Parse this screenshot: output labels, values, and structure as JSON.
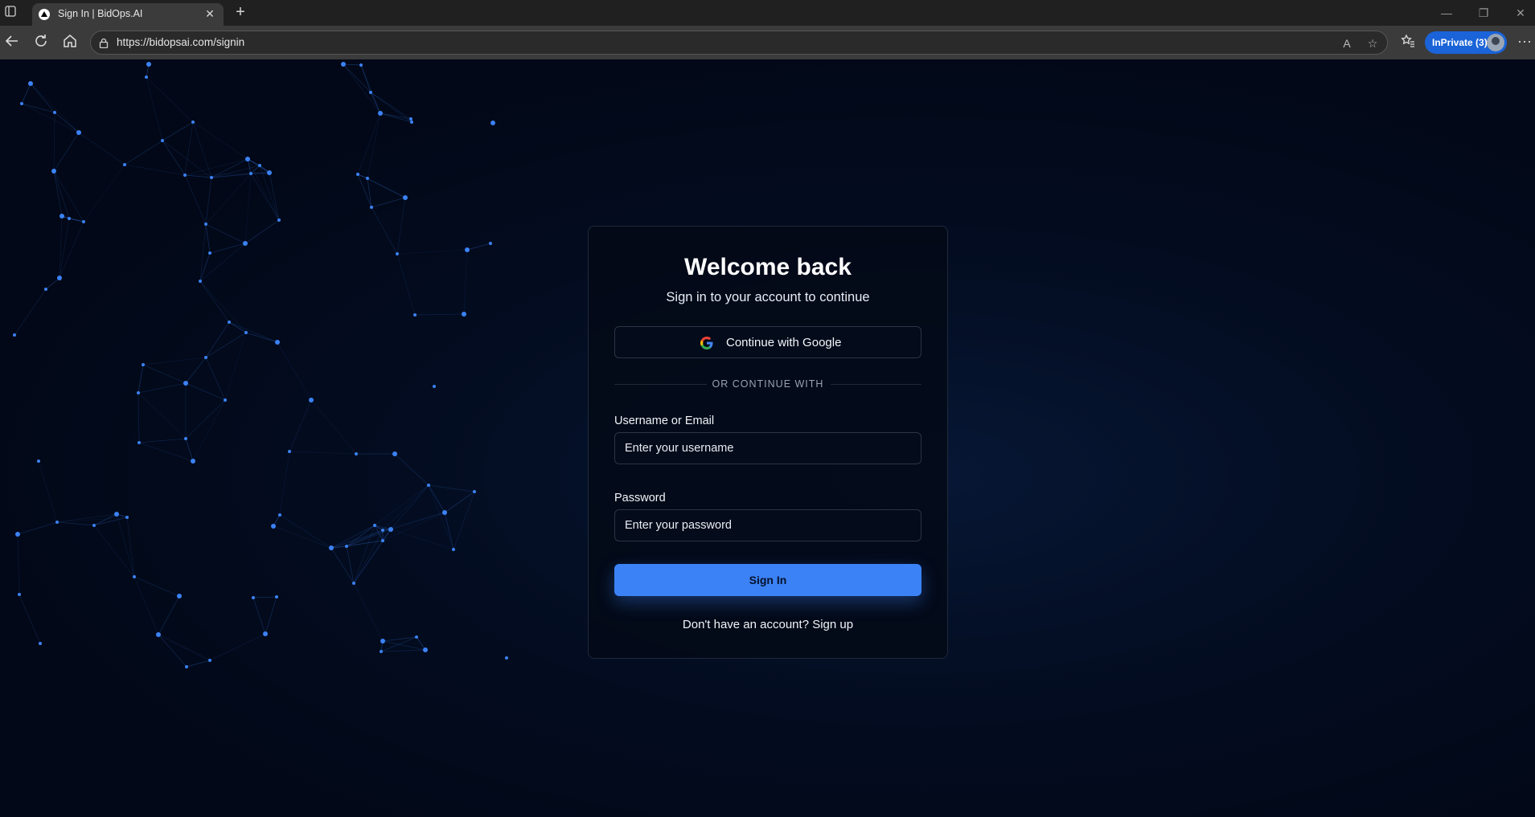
{
  "browser": {
    "tab_title": "Sign In | BidOps.AI",
    "url": "https://bidopsai.com/signin",
    "inprivate_label": "InPrivate (3)",
    "icons": [
      "tab-actions-icon",
      "favicon-icon",
      "close-icon",
      "new-tab-icon",
      "back-icon",
      "refresh-icon",
      "home-icon",
      "lock-icon",
      "read-aloud-icon",
      "favorite-star-icon",
      "favorites-icon",
      "more-icon",
      "minimize-icon",
      "restore-icon",
      "window-close-icon"
    ]
  },
  "signin": {
    "title": "Welcome back",
    "subtitle": "Sign in to your account to continue",
    "google_button": "Continue with Google",
    "divider": "OR CONTINUE WITH",
    "username_label": "Username or Email",
    "username_placeholder": "Enter your username",
    "password_label": "Password",
    "password_placeholder": "Enter your password",
    "submit_button": "Sign In",
    "signup_prompt": "Don't have an account?",
    "signup_link": "Sign up"
  },
  "colors": {
    "page_background": "#020817",
    "accent": "#3b82f6",
    "network_node": "#3b82f6"
  }
}
